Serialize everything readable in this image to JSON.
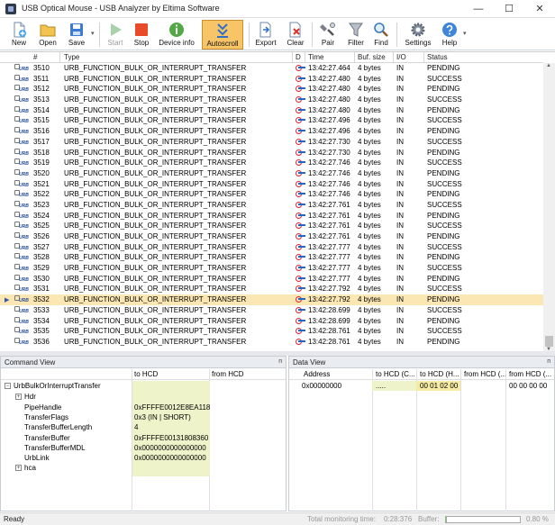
{
  "window": {
    "title": "USB Optical Mouse - USB Analyzer by Eltima Software",
    "minimize_glyph": "—",
    "maximize_glyph": "☐",
    "close_glyph": "✕"
  },
  "toolbar": {
    "new": "New",
    "open": "Open",
    "save": "Save",
    "start": "Start",
    "stop": "Stop",
    "device_info": "Device info",
    "autoscroll": "Autoscroll",
    "export": "Export",
    "clear": "Clear",
    "pair": "Pair",
    "filter": "Filter",
    "find": "Find",
    "settings": "Settings",
    "help": "Help",
    "dropdown_glyph": "▾"
  },
  "grid": {
    "columns": {
      "num": "#",
      "type": "Type",
      "dir": "D",
      "time": "Time",
      "buf": "Buf. size",
      "io": "I/O",
      "status": "Status"
    },
    "urb_label": "URB",
    "rows": [
      {
        "num": "3510",
        "type": "URB_FUNCTION_BULK_OR_INTERRUPT_TRANSFER",
        "time": "13:42:27.464",
        "buf": "4 bytes",
        "io": "IN",
        "status": "PENDING"
      },
      {
        "num": "3511",
        "type": "URB_FUNCTION_BULK_OR_INTERRUPT_TRANSFER",
        "time": "13:42:27.480",
        "buf": "4 bytes",
        "io": "IN",
        "status": "SUCCESS"
      },
      {
        "num": "3512",
        "type": "URB_FUNCTION_BULK_OR_INTERRUPT_TRANSFER",
        "time": "13:42:27.480",
        "buf": "4 bytes",
        "io": "IN",
        "status": "PENDING"
      },
      {
        "num": "3513",
        "type": "URB_FUNCTION_BULK_OR_INTERRUPT_TRANSFER",
        "time": "13:42:27.480",
        "buf": "4 bytes",
        "io": "IN",
        "status": "SUCCESS"
      },
      {
        "num": "3514",
        "type": "URB_FUNCTION_BULK_OR_INTERRUPT_TRANSFER",
        "time": "13:42:27.480",
        "buf": "4 bytes",
        "io": "IN",
        "status": "PENDING"
      },
      {
        "num": "3515",
        "type": "URB_FUNCTION_BULK_OR_INTERRUPT_TRANSFER",
        "time": "13:42:27.496",
        "buf": "4 bytes",
        "io": "IN",
        "status": "SUCCESS"
      },
      {
        "num": "3516",
        "type": "URB_FUNCTION_BULK_OR_INTERRUPT_TRANSFER",
        "time": "13:42:27.496",
        "buf": "4 bytes",
        "io": "IN",
        "status": "PENDING"
      },
      {
        "num": "3517",
        "type": "URB_FUNCTION_BULK_OR_INTERRUPT_TRANSFER",
        "time": "13:42:27.730",
        "buf": "4 bytes",
        "io": "IN",
        "status": "SUCCESS"
      },
      {
        "num": "3518",
        "type": "URB_FUNCTION_BULK_OR_INTERRUPT_TRANSFER",
        "time": "13:42:27.730",
        "buf": "4 bytes",
        "io": "IN",
        "status": "PENDING"
      },
      {
        "num": "3519",
        "type": "URB_FUNCTION_BULK_OR_INTERRUPT_TRANSFER",
        "time": "13:42:27.746",
        "buf": "4 bytes",
        "io": "IN",
        "status": "SUCCESS"
      },
      {
        "num": "3520",
        "type": "URB_FUNCTION_BULK_OR_INTERRUPT_TRANSFER",
        "time": "13:42:27.746",
        "buf": "4 bytes",
        "io": "IN",
        "status": "PENDING"
      },
      {
        "num": "3521",
        "type": "URB_FUNCTION_BULK_OR_INTERRUPT_TRANSFER",
        "time": "13:42:27.746",
        "buf": "4 bytes",
        "io": "IN",
        "status": "SUCCESS"
      },
      {
        "num": "3522",
        "type": "URB_FUNCTION_BULK_OR_INTERRUPT_TRANSFER",
        "time": "13:42:27.746",
        "buf": "4 bytes",
        "io": "IN",
        "status": "PENDING"
      },
      {
        "num": "3523",
        "type": "URB_FUNCTION_BULK_OR_INTERRUPT_TRANSFER",
        "time": "13:42:27.761",
        "buf": "4 bytes",
        "io": "IN",
        "status": "SUCCESS"
      },
      {
        "num": "3524",
        "type": "URB_FUNCTION_BULK_OR_INTERRUPT_TRANSFER",
        "time": "13:42:27.761",
        "buf": "4 bytes",
        "io": "IN",
        "status": "PENDING"
      },
      {
        "num": "3525",
        "type": "URB_FUNCTION_BULK_OR_INTERRUPT_TRANSFER",
        "time": "13:42:27.761",
        "buf": "4 bytes",
        "io": "IN",
        "status": "SUCCESS"
      },
      {
        "num": "3526",
        "type": "URB_FUNCTION_BULK_OR_INTERRUPT_TRANSFER",
        "time": "13:42:27.761",
        "buf": "4 bytes",
        "io": "IN",
        "status": "PENDING"
      },
      {
        "num": "3527",
        "type": "URB_FUNCTION_BULK_OR_INTERRUPT_TRANSFER",
        "time": "13:42:27.777",
        "buf": "4 bytes",
        "io": "IN",
        "status": "SUCCESS"
      },
      {
        "num": "3528",
        "type": "URB_FUNCTION_BULK_OR_INTERRUPT_TRANSFER",
        "time": "13:42:27.777",
        "buf": "4 bytes",
        "io": "IN",
        "status": "PENDING"
      },
      {
        "num": "3529",
        "type": "URB_FUNCTION_BULK_OR_INTERRUPT_TRANSFER",
        "time": "13:42:27.777",
        "buf": "4 bytes",
        "io": "IN",
        "status": "SUCCESS"
      },
      {
        "num": "3530",
        "type": "URB_FUNCTION_BULK_OR_INTERRUPT_TRANSFER",
        "time": "13:42:27.777",
        "buf": "4 bytes",
        "io": "IN",
        "status": "PENDING"
      },
      {
        "num": "3531",
        "type": "URB_FUNCTION_BULK_OR_INTERRUPT_TRANSFER",
        "time": "13:42:27.792",
        "buf": "4 bytes",
        "io": "IN",
        "status": "SUCCESS"
      },
      {
        "num": "3532",
        "type": "URB_FUNCTION_BULK_OR_INTERRUPT_TRANSFER",
        "time": "13:42:27.792",
        "buf": "4 bytes",
        "io": "IN",
        "status": "PENDING"
      },
      {
        "num": "3533",
        "type": "URB_FUNCTION_BULK_OR_INTERRUPT_TRANSFER",
        "time": "13:42:28.699",
        "buf": "4 bytes",
        "io": "IN",
        "status": "SUCCESS"
      },
      {
        "num": "3534",
        "type": "URB_FUNCTION_BULK_OR_INTERRUPT_TRANSFER",
        "time": "13:42:28.699",
        "buf": "4 bytes",
        "io": "IN",
        "status": "PENDING"
      },
      {
        "num": "3535",
        "type": "URB_FUNCTION_BULK_OR_INTERRUPT_TRANSFER",
        "time": "13:42:28.761",
        "buf": "4 bytes",
        "io": "IN",
        "status": "SUCCESS"
      },
      {
        "num": "3536",
        "type": "URB_FUNCTION_BULK_OR_INTERRUPT_TRANSFER",
        "time": "13:42:28.761",
        "buf": "4 bytes",
        "io": "IN",
        "status": "PENDING"
      }
    ],
    "selected_num": "3532",
    "selected_marker": "▶",
    "scroll_up_glyph": "▲",
    "scroll_down_glyph": "▼"
  },
  "command_view": {
    "title": "Command View",
    "pin_glyph": "ᴨ",
    "col_to_hcd": "to HCD",
    "col_from_hcd": "from HCD",
    "root": "UrbBulkOrInterruptTransfer",
    "hdr": "Hdr",
    "hca": "hca",
    "collapse_glyph": "−",
    "expand_glyph": "+",
    "fields": [
      {
        "k": "PipeHandle",
        "v": "0xFFFFE0012E8EA118"
      },
      {
        "k": "TransferFlags",
        "v": "0x3 (IN | SHORT)"
      },
      {
        "k": "TransferBufferLength",
        "v": "4"
      },
      {
        "k": "TransferBuffer",
        "v": "0xFFFFE00131808360"
      },
      {
        "k": "TransferBufferMDL",
        "v": "0x0000000000000000"
      },
      {
        "k": "UrbLink",
        "v": "0x0000000000000000"
      }
    ]
  },
  "data_view": {
    "title": "Data View",
    "pin_glyph": "ᴨ",
    "col_address": "Address",
    "col_to_hcd_c": "to HCD (C...",
    "col_to_hcd_h": "to HCD (H...",
    "col_from_hcd_c": "from HCD (...",
    "col_from_hcd_h": "from HCD (...",
    "row": {
      "address": "0x00000000",
      "to_c": ".....",
      "to_h": "00 01 02 00",
      "from_c": "",
      "from_h": "00 00 00 00"
    }
  },
  "statusbar": {
    "ready": "Ready",
    "total_time_label": "Total monitoring time:",
    "total_time": "0:28:376",
    "buffer_label": "Buffer:",
    "buffer_value": "0.80 %",
    "buffer_fraction": 0.008
  }
}
